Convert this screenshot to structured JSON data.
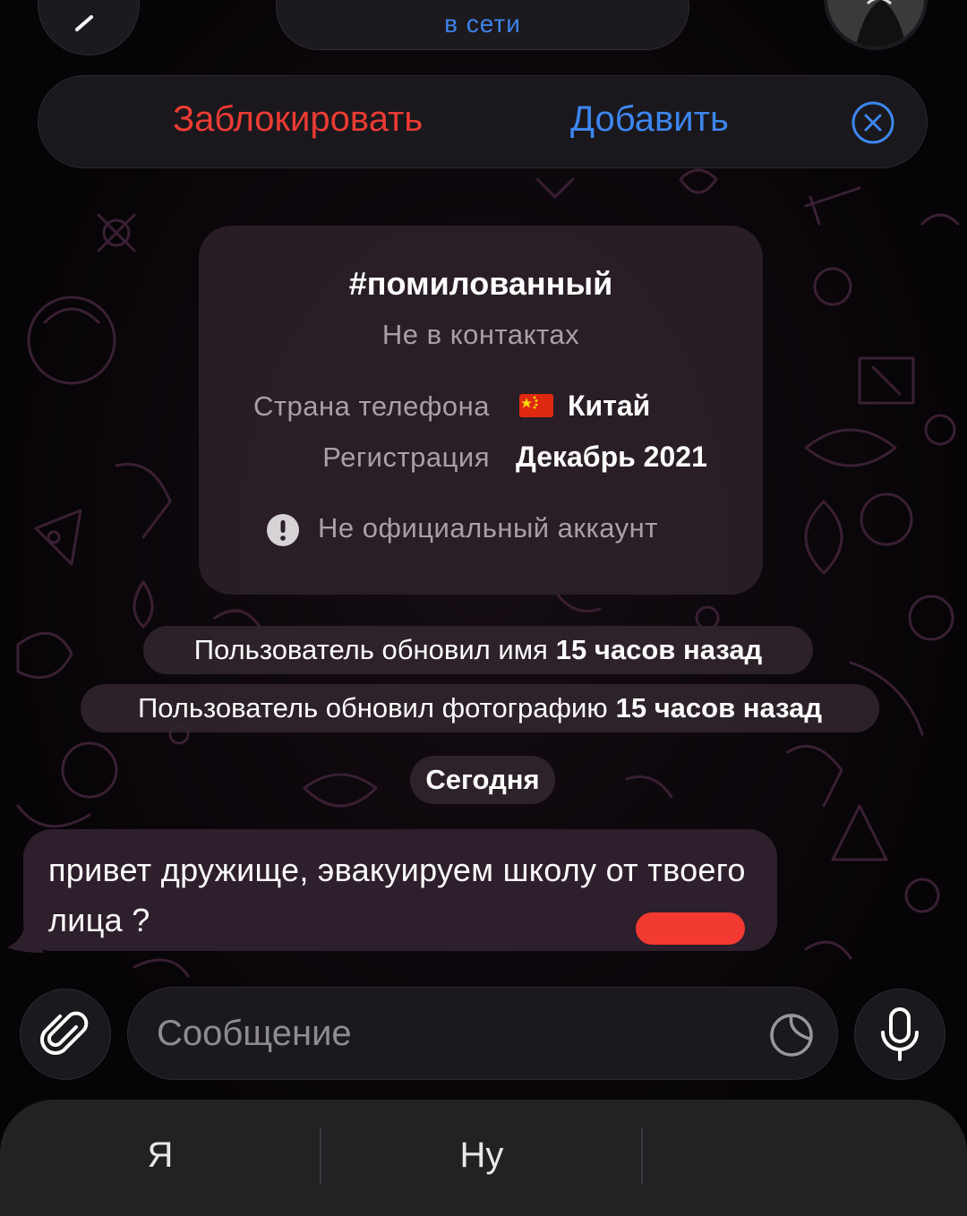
{
  "header": {
    "status": "в сети"
  },
  "action_bar": {
    "block_label": "Заблокировать",
    "add_label": "Добавить"
  },
  "info_card": {
    "title": "#помилованный",
    "subtitle": "Не в контактах",
    "rows": [
      {
        "label": "Страна телефона",
        "value": "Китай"
      },
      {
        "label": "Регистрация",
        "value": "Декабрь 2021"
      }
    ],
    "notice": "Не официальный аккаунт"
  },
  "service_messages": [
    {
      "text": "Пользователь обновил имя",
      "time": "15 часов назад"
    },
    {
      "text": "Пользователь обновил фотографию",
      "time": "15 часов назад"
    }
  ],
  "date_separator": "Сегодня",
  "message": {
    "text": "привет дружище, эвакуируем школу от твоего лица ?"
  },
  "composer": {
    "placeholder": "Сообщение"
  },
  "keyboard_suggestions": [
    "Я",
    "Ну",
    ""
  ],
  "colors": {
    "accent_blue": "#3d86f0",
    "danger_red": "#ec3b35",
    "bubble": "#2e1f2c"
  }
}
